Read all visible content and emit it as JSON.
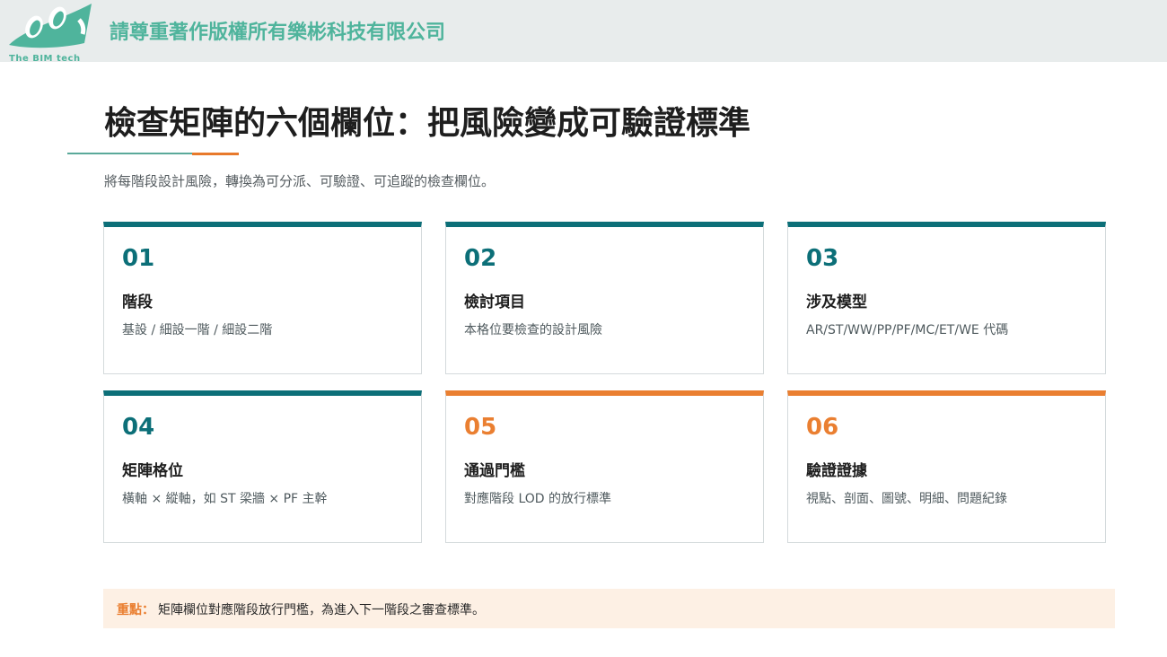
{
  "header": {
    "logo_text": "The BIM tech",
    "copyright": "請尊重著作版權所有樂彬科技有限公司",
    "colors": {
      "background": "#e8ecec",
      "brand": "#4fb49c"
    }
  },
  "title": "檢查矩陣的六個欄位：把風險變成可驗證標準",
  "subtitle": "將每階段設計風險，轉換為可分派、可驗證、可追蹤的檢查欄位。",
  "cards": [
    {
      "num": "01",
      "label": "階段",
      "desc": "基設 / 細設一階 / 細設二階",
      "accent": "#0c6f78"
    },
    {
      "num": "02",
      "label": "檢討項目",
      "desc": "本格位要檢查的設計風險",
      "accent": "#0c6f78"
    },
    {
      "num": "03",
      "label": "涉及模型",
      "desc": "AR/ST/WW/PP/PF/MC/ET/WE  代碼",
      "accent": "#0c6f78"
    },
    {
      "num": "04",
      "label": "矩陣格位",
      "desc": "橫軸 × 縱軸，如  ST 梁牆  × PF 主幹",
      "accent": "#0c6f78"
    },
    {
      "num": "05",
      "label": "通過門檻",
      "desc": "對應階段  LOD  的放行標準",
      "accent": "#ea7f31"
    },
    {
      "num": "06",
      "label": "驗證證據",
      "desc": "視點、剖面、圖號、明細、問題紀錄",
      "accent": "#ea7f31"
    }
  ],
  "note": {
    "key": "重點：",
    "text": "矩陣欄位對應階段放行門檻，為進入下一階段之審查標準。"
  }
}
